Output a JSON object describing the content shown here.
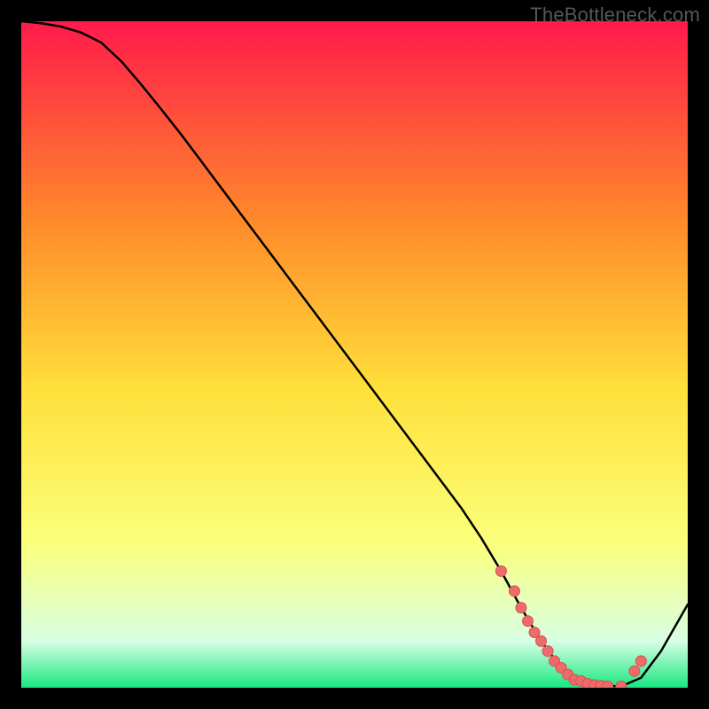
{
  "watermark": "TheBottleneck.com",
  "colors": {
    "gradient_top": "#ff1a4b",
    "gradient_mid1": "#ff8a2a",
    "gradient_mid2": "#ffe03a",
    "gradient_mid3": "#fbff7a",
    "gradient_low": "#d8ffe4",
    "gradient_bottom": "#18e880",
    "curve": "#000000",
    "marker_fill": "#ed6b6b",
    "marker_stroke": "#d94f4f"
  },
  "chart_data": {
    "type": "line",
    "title": "",
    "xlabel": "",
    "ylabel": "",
    "xlim": [
      0,
      100
    ],
    "ylim": [
      0,
      100
    ],
    "grid": false,
    "legend": false,
    "series": [
      {
        "name": "bottleneck-curve",
        "x": [
          0,
          3,
          6,
          9,
          12,
          15,
          18,
          21,
          24,
          27,
          30,
          33,
          36,
          39,
          42,
          45,
          48,
          51,
          54,
          57,
          60,
          63,
          66,
          69,
          72,
          75,
          78,
          81,
          84,
          87,
          90,
          93,
          96,
          100
        ],
        "y": [
          100,
          99.7,
          99.2,
          98.3,
          96.8,
          94.0,
          90.5,
          86.8,
          83.0,
          79.0,
          75.0,
          71.0,
          67.0,
          63.0,
          59.0,
          55.0,
          51.0,
          47.0,
          43.0,
          39.0,
          35.0,
          31.0,
          27.0,
          22.5,
          17.5,
          12.0,
          7.0,
          3.0,
          1.0,
          0.3,
          0.2,
          1.5,
          5.5,
          12.5
        ]
      }
    ],
    "markers": {
      "name": "optimal-zone",
      "x": [
        72,
        74,
        75,
        76,
        77,
        78,
        79,
        80,
        81,
        82,
        83,
        84,
        85,
        86,
        87,
        88,
        90,
        92,
        93
      ],
      "y": [
        17.5,
        14.5,
        12.0,
        10.0,
        8.3,
        7.0,
        5.5,
        4.0,
        3.0,
        2.0,
        1.2,
        1.0,
        0.6,
        0.4,
        0.3,
        0.2,
        0.2,
        2.5,
        4.0
      ]
    }
  }
}
